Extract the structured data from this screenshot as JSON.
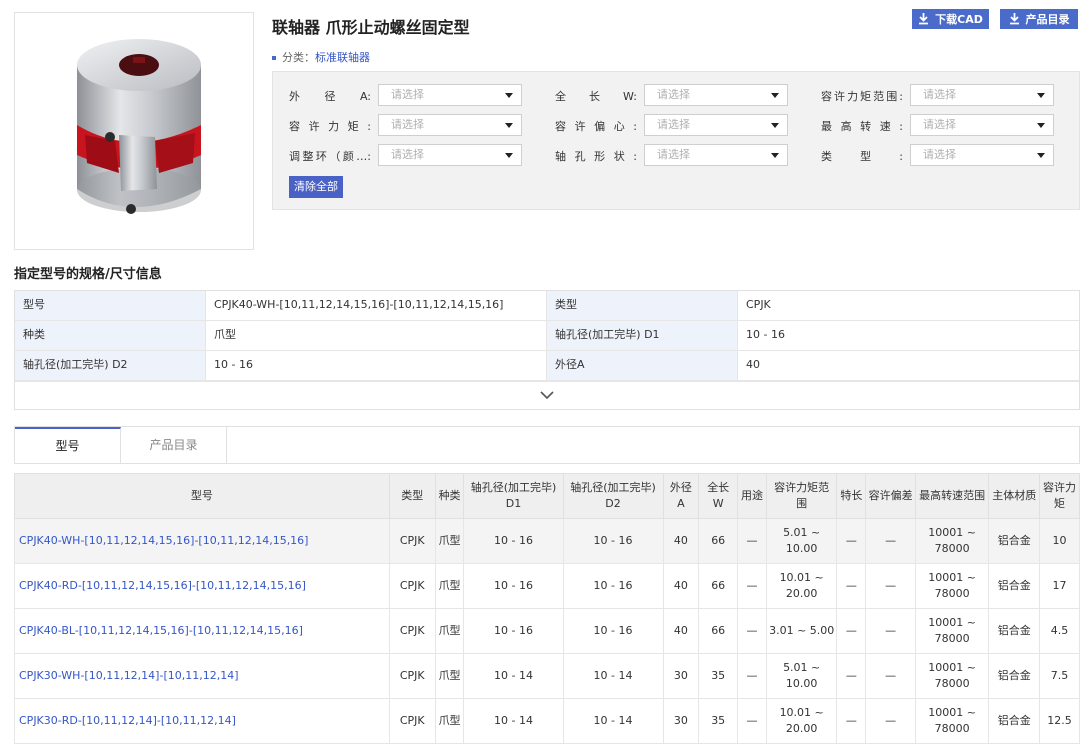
{
  "product": {
    "title": "联轴器 爪形止动螺丝固定型",
    "category_label": "分类：",
    "category_link": "标准联轴器"
  },
  "top_buttons": {
    "download_cad": "下载CAD",
    "catalog": "产品目录"
  },
  "filters": {
    "placeholder": "请选择",
    "labels": [
      "外径A:",
      "全长W:",
      "容许力矩范围:",
      "容许力矩:",
      "容许偏心:",
      "最高转速:",
      "调整环（颜…:",
      "轴孔形状:",
      "类型:"
    ],
    "clear_all": "清除全部"
  },
  "spec_section": {
    "heading": "指定型号的规格/尺寸信息",
    "rows": [
      {
        "k1": "型号",
        "v1": "CPJK40-WH-[10,11,12,14,15,16]-[10,11,12,14,15,16]",
        "k2": "类型",
        "v2": "CPJK"
      },
      {
        "k1": "种类",
        "v1": "爪型",
        "k2": "轴孔径(加工完毕) D1",
        "v2": "10 - 16"
      },
      {
        "k1": "轴孔径(加工完毕) D2",
        "v1": "10 - 16",
        "k2": "外径A",
        "v2": "40"
      }
    ]
  },
  "tabs": [
    "型号",
    "产品目录"
  ],
  "table": {
    "headers": [
      "型号",
      "类型",
      "种类",
      "轴孔径(加工完毕) D1",
      "轴孔径(加工完毕) D2",
      "外径 A",
      "全长 W",
      "用途",
      "容许力矩范围",
      "特长",
      "容许偏差",
      "最高转速范围",
      "主体材质",
      "容许力矩"
    ],
    "rows": [
      [
        "CPJK40-WH-[10,11,12,14,15,16]-[10,11,12,14,15,16]",
        "CPJK",
        "爪型",
        "10 - 16",
        "10 - 16",
        "40",
        "66",
        "—",
        "5.01 ~ 10.00",
        "—",
        "—",
        "10001 ~ 78000",
        "铝合金",
        "10"
      ],
      [
        "CPJK40-RD-[10,11,12,14,15,16]-[10,11,12,14,15,16]",
        "CPJK",
        "爪型",
        "10 - 16",
        "10 - 16",
        "40",
        "66",
        "—",
        "10.01 ~ 20.00",
        "—",
        "—",
        "10001 ~ 78000",
        "铝合金",
        "17"
      ],
      [
        "CPJK40-BL-[10,11,12,14,15,16]-[10,11,12,14,15,16]",
        "CPJK",
        "爪型",
        "10 - 16",
        "10 - 16",
        "40",
        "66",
        "—",
        "3.01 ~ 5.00",
        "—",
        "—",
        "10001 ~ 78000",
        "铝合金",
        "4.5"
      ],
      [
        "CPJK30-WH-[10,11,12,14]-[10,11,12,14]",
        "CPJK",
        "爪型",
        "10 - 14",
        "10 - 14",
        "30",
        "35",
        "—",
        "5.01 ~ 10.00",
        "—",
        "—",
        "10001 ~ 78000",
        "铝合金",
        "7.5"
      ],
      [
        "CPJK30-RD-[10,11,12,14]-[10,11,12,14]",
        "CPJK",
        "爪型",
        "10 - 14",
        "10 - 14",
        "30",
        "35",
        "—",
        "10.01 ~ 20.00",
        "—",
        "—",
        "10001 ~ 78000",
        "铝合金",
        "12.5"
      ]
    ]
  },
  "colors": {
    "accent": "#4a62c6",
    "link": "#3556c6",
    "coupling_red": "#c8141e"
  }
}
